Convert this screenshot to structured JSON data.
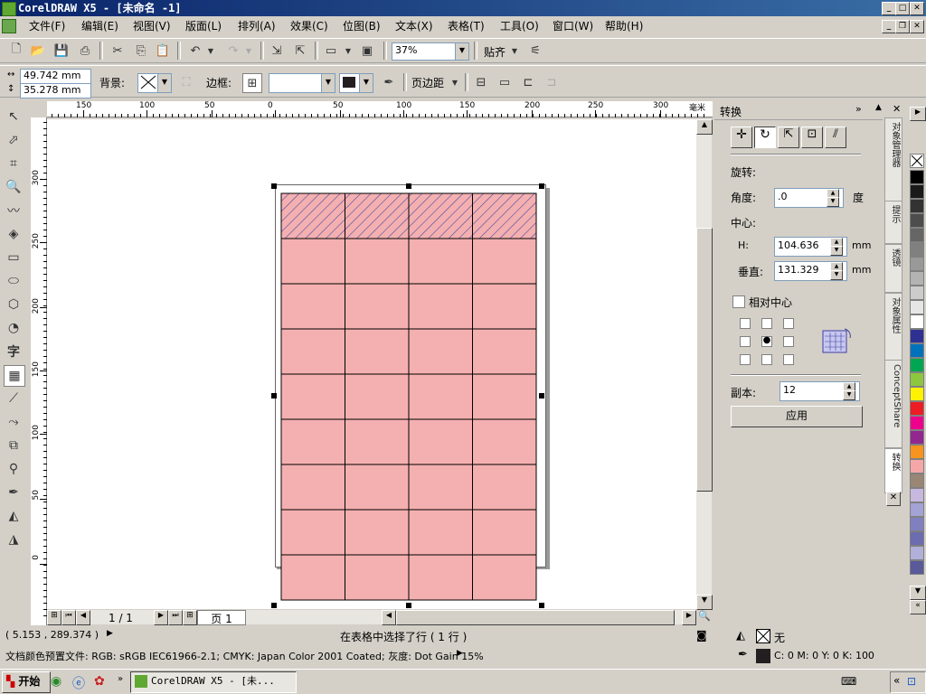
{
  "window": {
    "title": "CorelDRAW X5 - [未命名 -1]"
  },
  "menu": [
    "文件(F)",
    "编辑(E)",
    "视图(V)",
    "版面(L)",
    "排列(A)",
    "效果(C)",
    "位图(B)",
    "文本(X)",
    "表格(T)",
    "工具(O)",
    "窗口(W)",
    "帮助(H)"
  ],
  "toolbar": {
    "zoom": "37%",
    "snap_label": "贴齐"
  },
  "propbar": {
    "width_value": "49.742 mm",
    "height_value": "35.278 mm",
    "background_label": "背景:",
    "border_label": "边框:",
    "margin_label": "页边距"
  },
  "ruler": {
    "h_ticks": [
      "150",
      "100",
      "50",
      "0",
      "50",
      "100",
      "150",
      "200",
      "250",
      "300"
    ],
    "v_ticks": [
      "300",
      "250",
      "200",
      "150",
      "100",
      "50",
      "0"
    ],
    "unit": "毫米"
  },
  "pagenav": {
    "counter": "1 / 1",
    "page_tab": "页 1"
  },
  "docker": {
    "title": "转换",
    "rotate_label": "旋转:",
    "angle_label": "角度:",
    "angle_value": ".0",
    "angle_unit": "度",
    "center_label": "中心:",
    "h_label": "H:",
    "h_value": "104.636",
    "h_unit": "mm",
    "v_label": "垂直:",
    "v_value": "131.329",
    "v_unit": "mm",
    "relative_center_label": "相对中心",
    "copies_label": "副本:",
    "copies_value": "12",
    "apply_label": "应用"
  },
  "docker_tabs": [
    "对象管理器",
    "提示",
    "透镜",
    "对象属性",
    "ConceptShare",
    "转换"
  ],
  "palette": [
    "#000000",
    "#1a1a1a",
    "#333333",
    "#4d4d4d",
    "#666666",
    "#808080",
    "#999999",
    "#b3b3b3",
    "#cccccc",
    "#e6e6e6",
    "#ffffff",
    "#2e3192",
    "#0072bc",
    "#00a651",
    "#8dc63f",
    "#fff200",
    "#ed1c24",
    "#ec008c",
    "#92278f",
    "#f7941d",
    "#f4a7a7",
    "#998675",
    "#c7b8e0",
    "#a3a3d6",
    "#8080c0",
    "#6c6cb0",
    "#b0b0d8",
    "#5a5a9a"
  ],
  "status": {
    "coords": "( 5.153 , 289.374 )",
    "message": "在表格中选择了行 ( 1 行 )",
    "fill_none": "无",
    "color_profile": "文档颜色预置文件: RGB: sRGB IEC61966-2.1; CMYK: Japan Color 2001 Coated; 灰度: Dot Gain 15%",
    "outline_cmyk": "C: 0 M: 0 Y: 0 K: 100"
  },
  "taskbar": {
    "start_label": "开始",
    "task_label": "CorelDRAW X5 - [未..."
  },
  "table": {
    "rows": 9,
    "cols": 4,
    "fill_color": "#f4b0b0",
    "selected_row": 1
  }
}
